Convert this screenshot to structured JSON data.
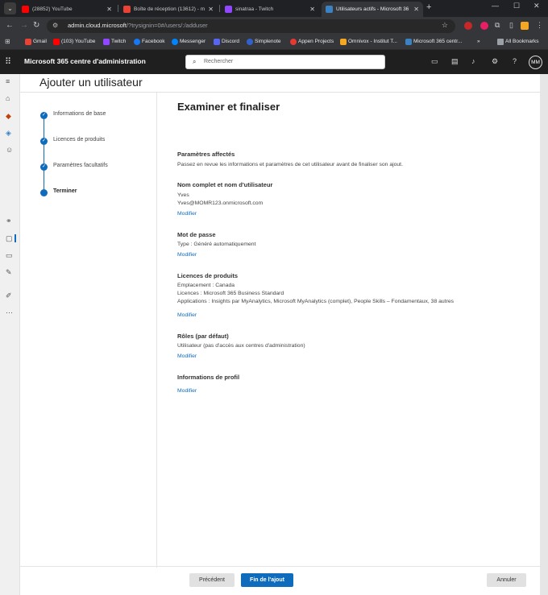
{
  "browser": {
    "tabs": [
      {
        "title": "(28852) YouTube",
        "color": "#ff0000"
      },
      {
        "title": "Boîte de réception (13612) - m",
        "color": "#ea4335"
      },
      {
        "title": "sinatraa - Twitch",
        "color": "#9146ff"
      },
      {
        "title": "Utilisateurs actifs - Microsoft 36",
        "color": "#3b82c4",
        "active": true
      }
    ],
    "url_host": "admin.cloud.microsoft",
    "url_path": "/?trysignin=0#/users/:/adduser",
    "bookmarks": [
      {
        "label": "Gmail",
        "color": "#ea4335"
      },
      {
        "label": "(103) YouTube",
        "color": "#ff0000"
      },
      {
        "label": "Twitch",
        "color": "#9146ff"
      },
      {
        "label": "Facebook",
        "color": "#1877f2"
      },
      {
        "label": "Messenger",
        "color": "#0084ff"
      },
      {
        "label": "Discord",
        "color": "#5865f2"
      },
      {
        "label": "Simplenote",
        "color": "#3361cc"
      },
      {
        "label": "Appen Projects",
        "color": "#e53935"
      },
      {
        "label": "Omnivox - Institut T...",
        "color": "#f5a623"
      },
      {
        "label": "Microsoft 365 centr...",
        "color": "#3b82c4"
      }
    ],
    "all_bookmarks": "All Bookmarks"
  },
  "app": {
    "title": "Microsoft 365 centre d'administration",
    "search_placeholder": "Rechercher",
    "avatar_initials": "MM"
  },
  "panel": {
    "title": "Ajouter un utilisateur",
    "steps": [
      {
        "label": "Informations de base",
        "done": true
      },
      {
        "label": "Licences de produits",
        "done": true
      },
      {
        "label": "Paramètres facultatifs",
        "done": true
      },
      {
        "label": "Terminer",
        "current": true
      }
    ]
  },
  "review": {
    "heading": "Examiner et finaliser",
    "settings_title": "Paramètres affectés",
    "settings_desc": "Passez en revue les informations et paramètres de cet utilisateur avant de finaliser son ajout.",
    "name_section": {
      "title": "Nom complet et nom d'utilisateur",
      "lines": [
        "Yves",
        "Yves@MOMR123.onmicrosoft.com"
      ],
      "link": "Modifier"
    },
    "password_section": {
      "title": "Mot de passe",
      "lines": [
        "Type : Généré automatiquement"
      ],
      "link": "Modifier"
    },
    "licenses_section": {
      "title": "Licences de produits",
      "lines": [
        "Emplacement : Canada",
        "Licences : Microsoft 365 Business Standard",
        "Applications : Insights par MyAnalytics, Microsoft MyAnalytics (complet), People Skills – Fondamentaux, 38 autres"
      ],
      "link": "Modifier"
    },
    "roles_section": {
      "title": "Rôles (par défaut)",
      "lines": [
        "Utilisateur (pas d'accès aux centres d'administration)"
      ],
      "link": "Modifier"
    },
    "profile_section": {
      "title": "Informations de profil",
      "link": "Modifier"
    }
  },
  "footer": {
    "back": "Précédent",
    "finish": "Fin de l'ajout",
    "cancel": "Annuler"
  },
  "colors": {
    "accent": "#0f6cbd",
    "header_bg": "#1f1f1f"
  }
}
